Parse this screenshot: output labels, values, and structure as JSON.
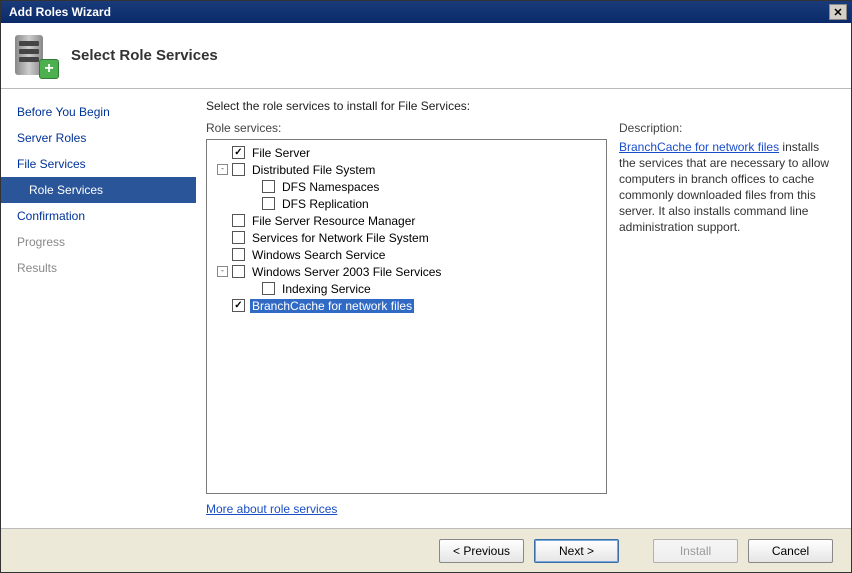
{
  "window": {
    "title": "Add Roles Wizard"
  },
  "header": {
    "title": "Select Role Services"
  },
  "sidebar": {
    "steps": [
      {
        "label": "Before You Begin",
        "cls": ""
      },
      {
        "label": "Server Roles",
        "cls": ""
      },
      {
        "label": "File Services",
        "cls": ""
      },
      {
        "label": "Role Services",
        "cls": "sub active"
      },
      {
        "label": "Confirmation",
        "cls": ""
      },
      {
        "label": "Progress",
        "cls": "muted"
      },
      {
        "label": "Results",
        "cls": "muted"
      }
    ]
  },
  "main": {
    "instruction": "Select the role services to install for File Services:",
    "role_services_label": "Role services:",
    "description_label": "Description:",
    "more_link": "More about role services"
  },
  "tree": [
    {
      "indent": 0,
      "expander": "",
      "checked": true,
      "label": "File Server",
      "selected": false
    },
    {
      "indent": 0,
      "expander": "-",
      "checked": false,
      "label": "Distributed File System",
      "selected": false
    },
    {
      "indent": 1,
      "expander": "",
      "checked": false,
      "label": "DFS Namespaces",
      "selected": false
    },
    {
      "indent": 1,
      "expander": "",
      "checked": false,
      "label": "DFS Replication",
      "selected": false
    },
    {
      "indent": 0,
      "expander": "",
      "checked": false,
      "label": "File Server Resource Manager",
      "selected": false
    },
    {
      "indent": 0,
      "expander": "",
      "checked": false,
      "label": "Services for Network File System",
      "selected": false
    },
    {
      "indent": 0,
      "expander": "",
      "checked": false,
      "label": "Windows Search Service",
      "selected": false
    },
    {
      "indent": 0,
      "expander": "-",
      "checked": false,
      "label": "Windows Server 2003 File Services",
      "selected": false
    },
    {
      "indent": 1,
      "expander": "",
      "checked": false,
      "label": "Indexing Service",
      "selected": false
    },
    {
      "indent": 0,
      "expander": "",
      "checked": true,
      "label": "BranchCache for network files",
      "selected": true
    }
  ],
  "description": {
    "link": "BranchCache for network files",
    "text": " installs the services that are necessary to allow computers in branch offices to cache commonly downloaded files from this server. It also installs command line administration support."
  },
  "footer": {
    "previous": "< Previous",
    "next": "Next >",
    "install": "Install",
    "cancel": "Cancel"
  }
}
